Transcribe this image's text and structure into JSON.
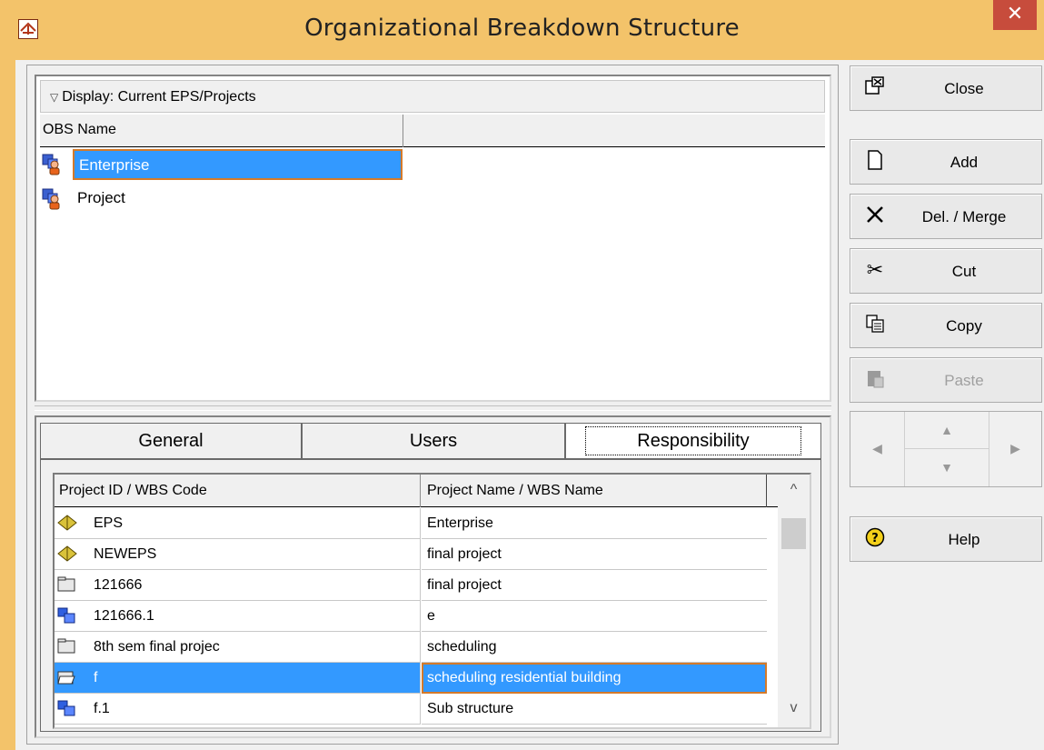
{
  "window": {
    "title": "Organizational Breakdown Structure",
    "close_glyph": "✕"
  },
  "obs": {
    "display_label": "Display: Current EPS/Projects",
    "column_name": "OBS Name",
    "rows": [
      {
        "label": "Enterprise",
        "selected": true,
        "icon": "obs-person-icon"
      },
      {
        "label": "Project",
        "selected": false,
        "icon": "obs-person-icon"
      }
    ]
  },
  "tabs": {
    "general": "General",
    "users": "Users",
    "responsibility": "Responsibility",
    "active": "responsibility"
  },
  "grid": {
    "col_id": "Project ID / WBS Code",
    "col_name": "Project Name / WBS Name",
    "rows": [
      {
        "id": "EPS",
        "name": "Enterprise",
        "icon": "eps-icon",
        "selected": false
      },
      {
        "id": "NEWEPS",
        "name": "final project",
        "icon": "eps-icon",
        "selected": false
      },
      {
        "id": "121666",
        "name": "final project",
        "icon": "project-folder-icon",
        "selected": false
      },
      {
        "id": "121666.1",
        "name": "e",
        "icon": "wbs-icon",
        "selected": false
      },
      {
        "id": "8th sem final projec",
        "name": "scheduling",
        "icon": "project-folder-icon",
        "selected": false
      },
      {
        "id": "f",
        "name": "scheduling residential building",
        "icon": "open-folder-icon",
        "selected": true
      },
      {
        "id": "f.1",
        "name": "Sub structure",
        "icon": "wbs-icon",
        "selected": false
      }
    ]
  },
  "buttons": {
    "close": "Close",
    "add": "Add",
    "del_merge": "Del. / Merge",
    "cut": "Cut",
    "copy": "Copy",
    "paste": "Paste",
    "help": "Help"
  },
  "colors": {
    "selection": "#3399ff",
    "selection_border": "#d47a2a",
    "frame": "#f3c36a",
    "close_button": "#c74c3c"
  }
}
